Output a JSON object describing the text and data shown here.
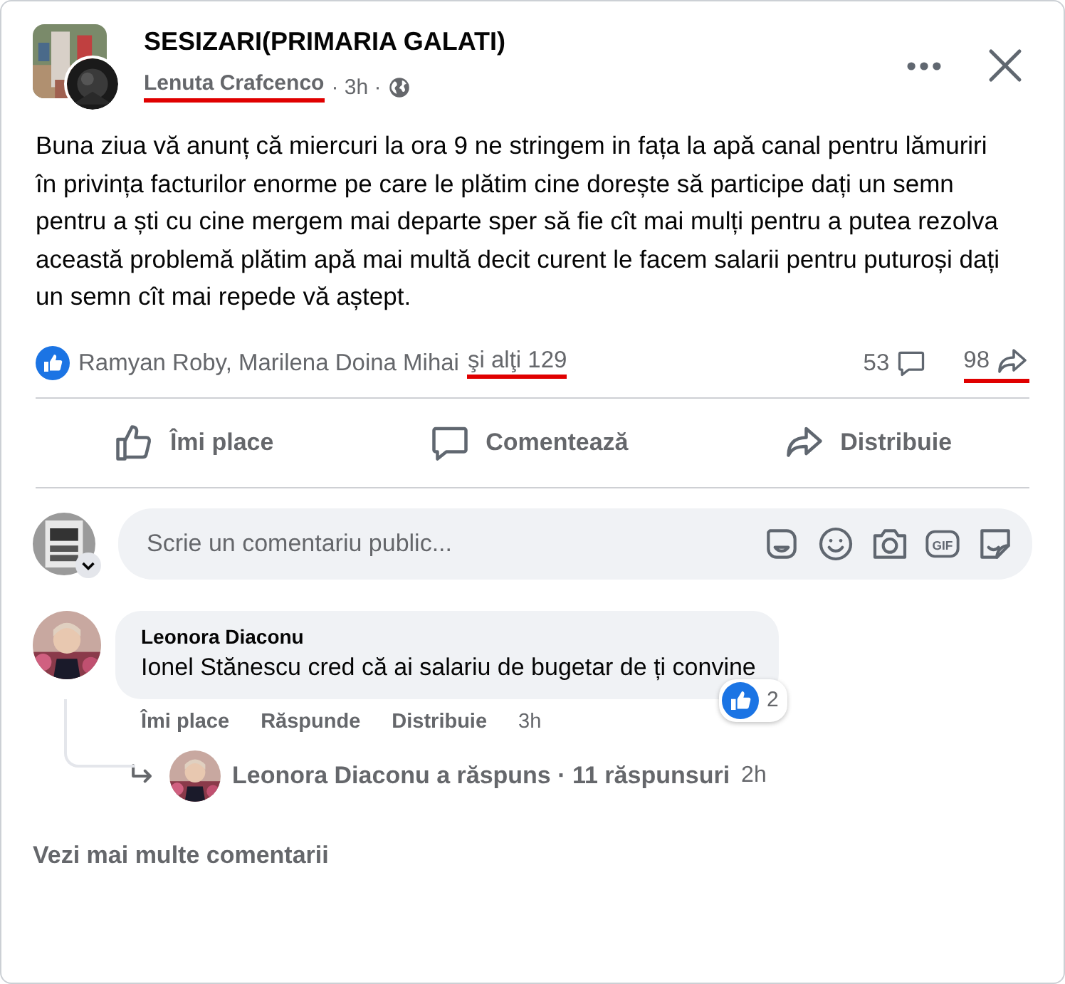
{
  "group": {
    "name": "SESIZARI(PRIMARIA GALATI)"
  },
  "post": {
    "author": "Lenuta Crafcenco",
    "author_highlighted": true,
    "meta": "· 3h ·",
    "text": "Buna ziua vă anunț că miercuri la ora 9 ne stringem in fața la apă canal pentru lămuriri în privința facturilor enorme pe care le plătim cine dorește să participe dați un semn pentru a ști cu cine mergem mai departe sper să fie cît mai mulți pentru a putea rezolva această problemă plătim apă mai multă decit curent le facem salarii pentru puturoși dați un semn cît mai repede vă aștept."
  },
  "reactions": {
    "names": "Ramyan Roby, Marilena Doina Mihai",
    "others": "şi alţi 129",
    "others_highlighted": true,
    "comments_count": "53",
    "shares_count": "98",
    "shares_highlighted": true
  },
  "actions": [
    {
      "label": "Îmi place",
      "kind": "like"
    },
    {
      "label": "Comentează",
      "kind": "comment"
    },
    {
      "label": "Distribuie",
      "kind": "share"
    }
  ],
  "composer": {
    "placeholder": "Scrie un comentariu public...",
    "tools": [
      {
        "kind": "avatar"
      },
      {
        "kind": "emoji"
      },
      {
        "kind": "camera"
      },
      {
        "kind": "gif",
        "label": "GIF"
      },
      {
        "kind": "sticker"
      }
    ]
  },
  "comments": [
    {
      "author": "Leonora Diaconu",
      "text": "Ionel Stănescu cred că ai salariu de bugetar de ți convine",
      "reaction_count": "2",
      "actions": [
        "Îmi place",
        "Răspunde",
        "Distribuie"
      ],
      "time": "3h",
      "reply": {
        "text": "Leonora Diaconu a răspuns · 11 răspunsuri",
        "time": "2h"
      }
    }
  ],
  "more_comments": "Vezi mai multe comentarii"
}
